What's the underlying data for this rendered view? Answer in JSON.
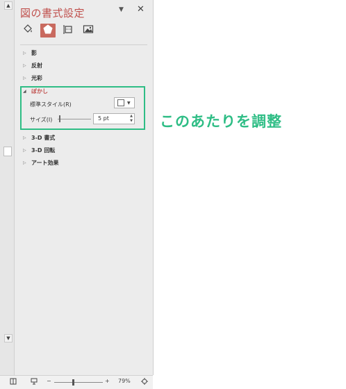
{
  "pane": {
    "title": "図の書式設定",
    "menu_glyph": "▼",
    "close_glyph": "✕",
    "tabs": [
      {
        "icon": "fill-bucket-icon"
      },
      {
        "icon": "pentagon-effects-icon",
        "active": true
      },
      {
        "icon": "size-layout-icon"
      },
      {
        "icon": "picture-icon"
      }
    ],
    "sections": {
      "shadow": "影",
      "reflection": "反射",
      "glow": "光彩",
      "soft_edges": "ぼかし",
      "format_3d": "3-D 書式",
      "rotation_3d": "3-D 回転",
      "artistic": "アート効果"
    },
    "soft_edges_fields": {
      "preset_label": "標準スタイル(R)",
      "size_label": "サイズ(I)",
      "size_value": "5 pt",
      "size_level_fraction": 0.05
    }
  },
  "annotation": {
    "text": "このあたりを調整",
    "color": "#2ebd85"
  },
  "status_bar": {
    "minus": "−",
    "plus": "+",
    "zoom": "79%"
  },
  "colors": {
    "accent": "#c0504d",
    "highlight": "#2ebd85",
    "pane_bg": "#ececec"
  }
}
